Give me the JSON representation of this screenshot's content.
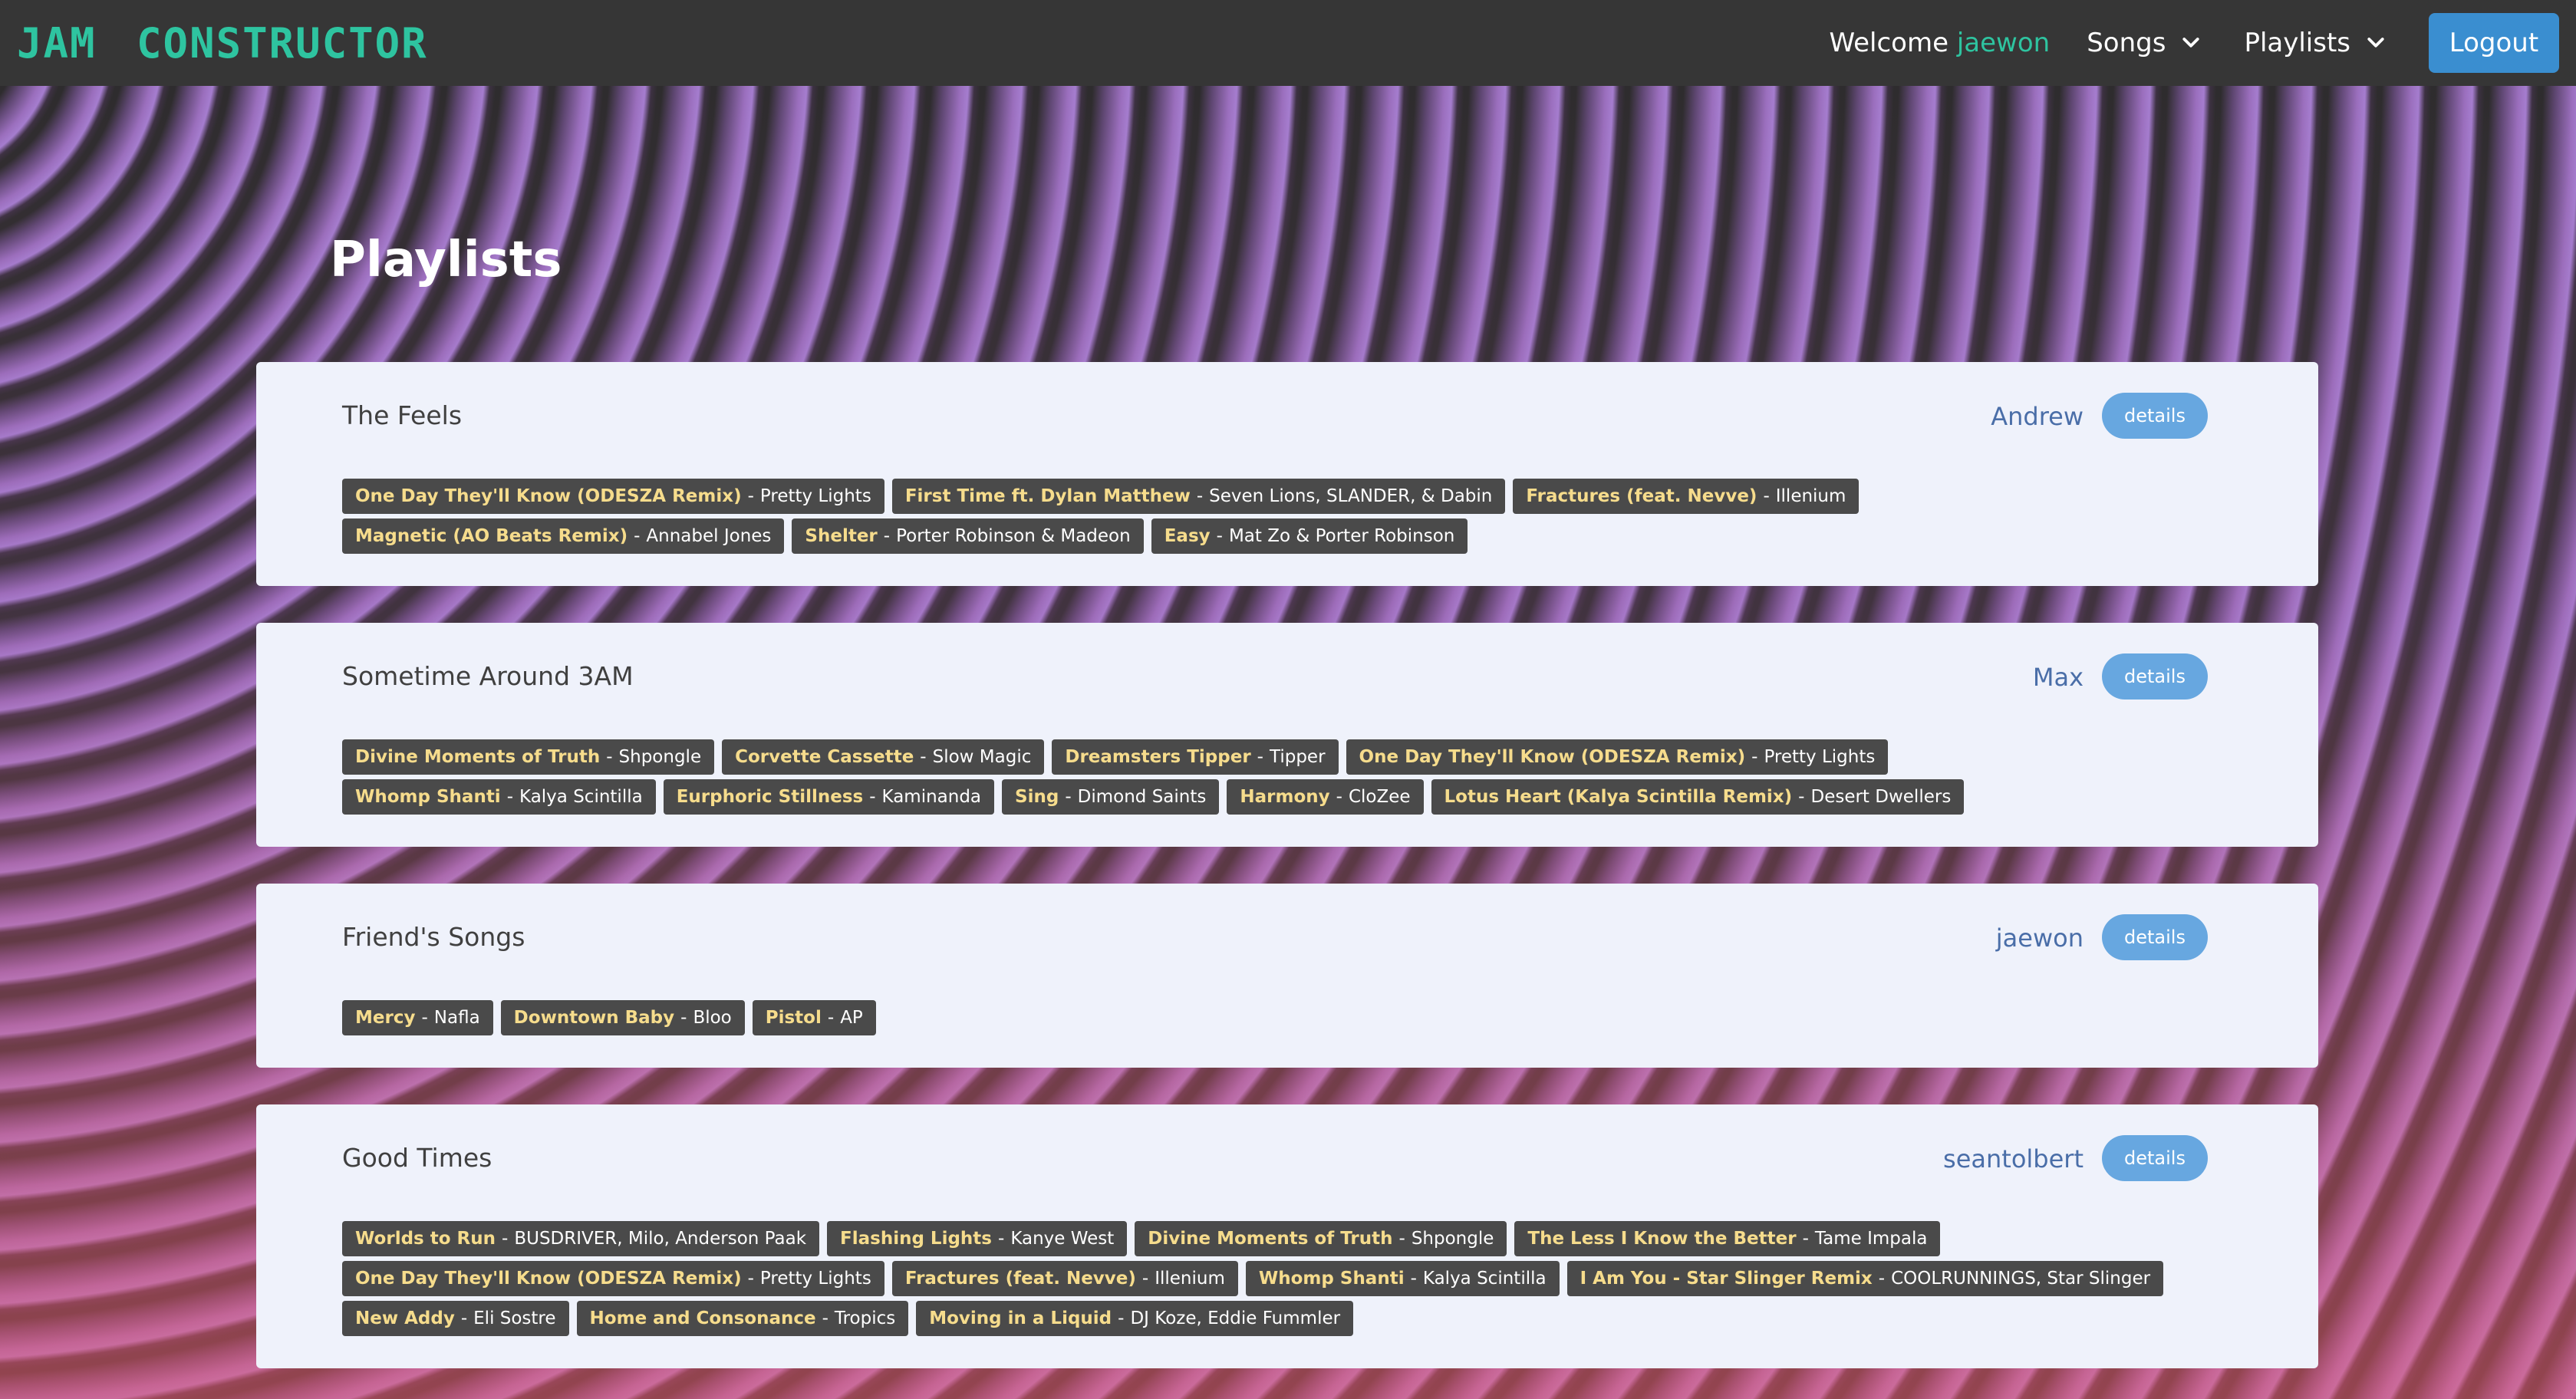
{
  "app": {
    "brand": "JAM CONSTRUCTOR"
  },
  "nav": {
    "welcome_label": "Welcome",
    "username": "jaewon",
    "songs_label": "Songs",
    "playlists_label": "Playlists",
    "logout_label": "Logout"
  },
  "page": {
    "title": "Playlists",
    "details_label": "details",
    "separator": "-"
  },
  "playlists": [
    {
      "name": "The Feels",
      "owner": "Andrew",
      "songs": [
        {
          "title": "One Day They'll Know (ODESZA Remix)",
          "artist": "Pretty Lights"
        },
        {
          "title": "First Time ft. Dylan Matthew",
          "artist": "Seven Lions, SLANDER, & Dabin"
        },
        {
          "title": "Fractures (feat. Nevve)",
          "artist": "Illenium"
        },
        {
          "title": "Magnetic (AO Beats Remix)",
          "artist": "Annabel Jones"
        },
        {
          "title": "Shelter",
          "artist": "Porter Robinson & Madeon"
        },
        {
          "title": "Easy",
          "artist": "Mat Zo & Porter Robinson"
        }
      ]
    },
    {
      "name": "Sometime Around 3AM",
      "owner": "Max",
      "songs": [
        {
          "title": "Divine Moments of Truth",
          "artist": "Shpongle"
        },
        {
          "title": "Corvette Cassette",
          "artist": "Slow Magic"
        },
        {
          "title": "Dreamsters Tipper",
          "artist": "Tipper"
        },
        {
          "title": "One Day They'll Know (ODESZA Remix)",
          "artist": "Pretty Lights"
        },
        {
          "title": "Whomp Shanti",
          "artist": "Kalya Scintilla"
        },
        {
          "title": "Eurphoric Stillness",
          "artist": "Kaminanda"
        },
        {
          "title": "Sing",
          "artist": "Dimond Saints"
        },
        {
          "title": "Harmony",
          "artist": "CloZee"
        },
        {
          "title": "Lotus Heart (Kalya Scintilla Remix)",
          "artist": "Desert Dwellers"
        }
      ]
    },
    {
      "name": "Friend's Songs",
      "owner": "jaewon",
      "songs": [
        {
          "title": "Mercy",
          "artist": "Nafla"
        },
        {
          "title": "Downtown Baby",
          "artist": "Bloo"
        },
        {
          "title": "Pistol",
          "artist": "AP"
        }
      ]
    },
    {
      "name": "Good Times",
      "owner": "seantolbert",
      "songs": [
        {
          "title": "Worlds to Run",
          "artist": "BUSDRIVER, Milo, Anderson Paak"
        },
        {
          "title": "Flashing Lights",
          "artist": "Kanye West"
        },
        {
          "title": "Divine Moments of Truth",
          "artist": "Shpongle"
        },
        {
          "title": "The Less I Know the Better",
          "artist": "Tame Impala"
        },
        {
          "title": "One Day They'll Know (ODESZA Remix)",
          "artist": "Pretty Lights"
        },
        {
          "title": "Fractures (feat. Nevve)",
          "artist": "Illenium"
        },
        {
          "title": "Whomp Shanti",
          "artist": "Kalya Scintilla"
        },
        {
          "title": "I Am You - Star Slinger Remix",
          "artist": "COOLRUNNINGS, Star Slinger"
        },
        {
          "title": "New Addy",
          "artist": "Eli Sostre"
        },
        {
          "title": "Home and Consonance",
          "artist": "Tropics"
        },
        {
          "title": "Moving in a Liquid",
          "artist": "DJ Koze, Eddie Fummler"
        }
      ]
    }
  ]
}
